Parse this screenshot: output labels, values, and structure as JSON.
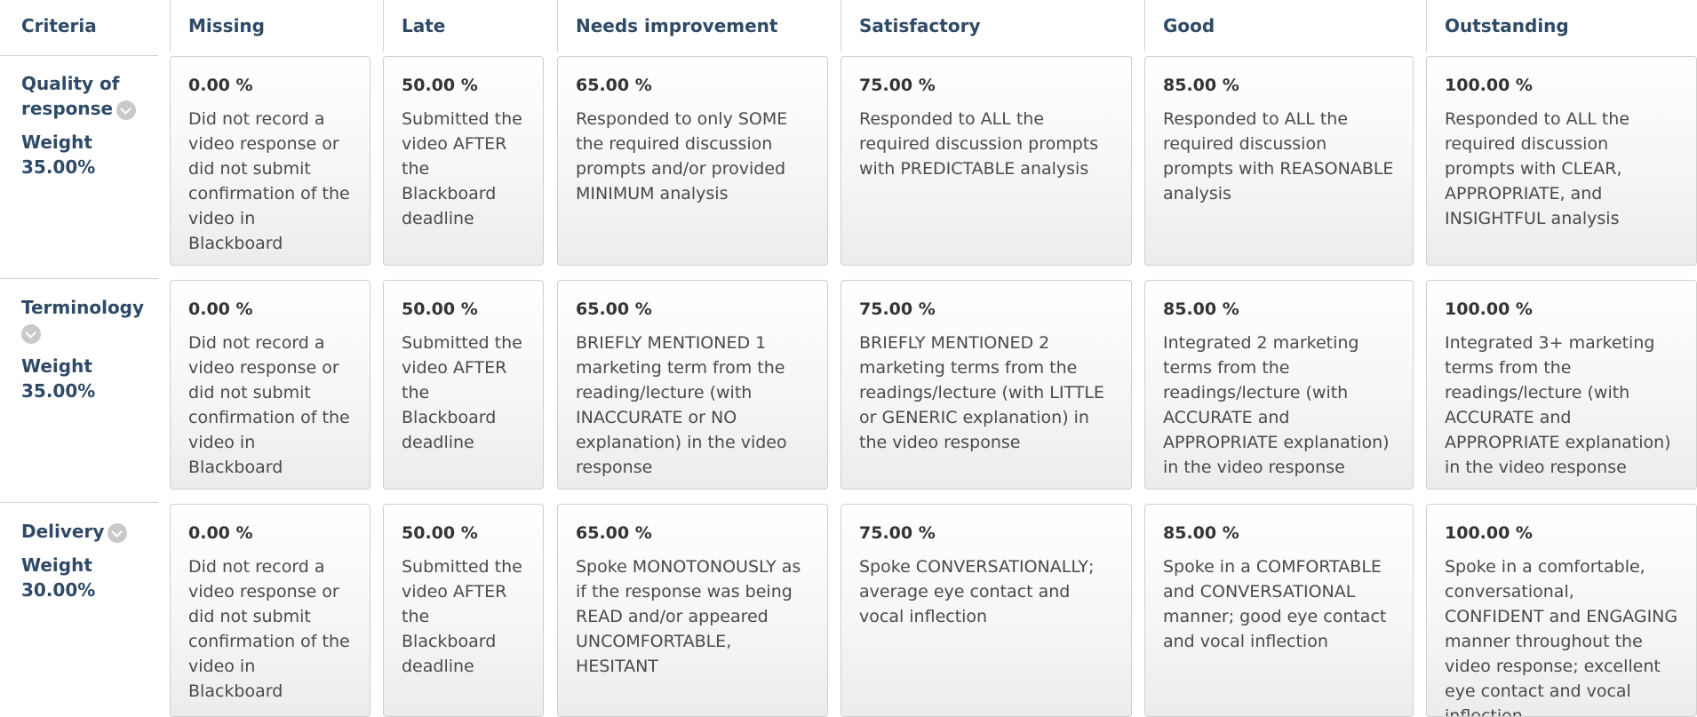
{
  "header": {
    "criteria": "Criteria",
    "levels": [
      "Missing",
      "Late",
      "Needs improvement",
      "Satisfactory",
      "Good",
      "Outstanding"
    ]
  },
  "weight_label": "Weight",
  "criteria": [
    {
      "name": "Quality of response",
      "weight": "35.00%",
      "cells": [
        {
          "pct": "0.00 %",
          "text": "Did not record a video response or did not submit confirmation of the video in Blackboard"
        },
        {
          "pct": "50.00 %",
          "text": "Submitted the video AFTER the Blackboard deadline"
        },
        {
          "pct": "65.00 %",
          "text": "Responded to only SOME the required discussion prompts and/or provided MINIMUM analysis"
        },
        {
          "pct": "75.00 %",
          "text": "Responded to ALL the required discussion prompts with PREDICTABLE analysis"
        },
        {
          "pct": "85.00 %",
          "text": "Responded to ALL the required discussion prompts with REASONABLE analysis"
        },
        {
          "pct": "100.00 %",
          "text": "Responded to ALL the required discussion prompts with CLEAR, APPROPRIATE, and INSIGHTFUL analysis"
        }
      ]
    },
    {
      "name": "Terminology",
      "weight": "35.00%",
      "cells": [
        {
          "pct": "0.00 %",
          "text": "Did not record a video response or did not submit confirmation of the video in Blackboard"
        },
        {
          "pct": "50.00 %",
          "text": "Submitted the video AFTER the Blackboard deadline"
        },
        {
          "pct": "65.00 %",
          "text": "BRIEFLY MENTIONED 1 marketing term from the reading/lecture (with INACCURATE or NO explanation) in the video response"
        },
        {
          "pct": "75.00 %",
          "text": "BRIEFLY MENTIONED 2 marketing terms from the readings/lecture (with LITTLE or GENERIC explanation) in the video response"
        },
        {
          "pct": "85.00 %",
          "text": "Integrated 2 marketing terms from the readings/lecture (with ACCURATE and APPROPRIATE explanation) in the video response"
        },
        {
          "pct": "100.00 %",
          "text": "Integrated 3+ marketing terms from the readings/lecture (with ACCURATE and APPROPRIATE explanation) in the video response"
        }
      ]
    },
    {
      "name": "Delivery",
      "weight": "30.00%",
      "cells": [
        {
          "pct": "0.00 %",
          "text": "Did not record a video response or did not submit confirmation of the video in Blackboard"
        },
        {
          "pct": "50.00 %",
          "text": "Submitted the video AFTER the Blackboard deadline"
        },
        {
          "pct": "65.00 %",
          "text": "Spoke MONOTONOUSLY as if the response was being READ and/or appeared UNCOMFORTABLE, HESITANT"
        },
        {
          "pct": "75.00 %",
          "text": "Spoke CONVERSATIONALLY; average eye contact and vocal inflection"
        },
        {
          "pct": "85.00 %",
          "text": "Spoke in a COMFORTABLE and CONVERSATIONAL manner; good eye contact and vocal inflection"
        },
        {
          "pct": "100.00 %",
          "text": "Spoke in a comfortable, conversational, CONFIDENT and ENGAGING manner throughout the video response; excellent eye contact and vocal inflection"
        }
      ]
    }
  ]
}
